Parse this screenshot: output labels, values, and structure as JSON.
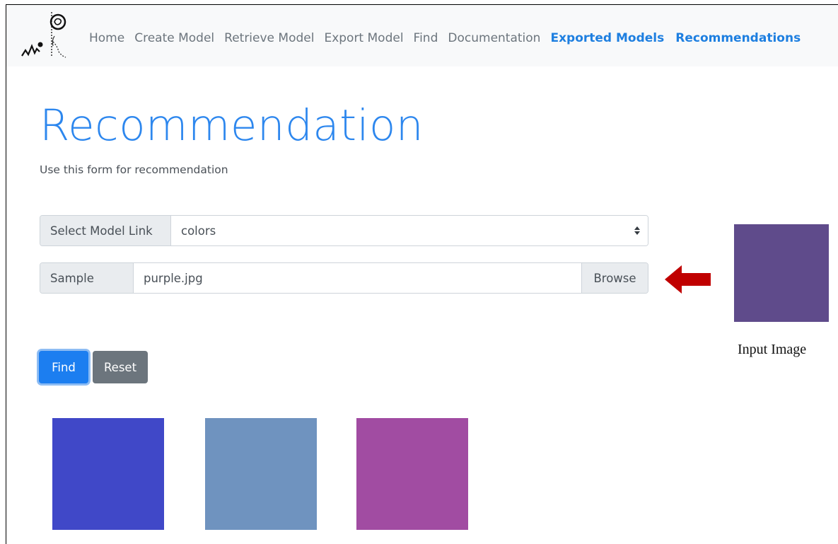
{
  "navbar": {
    "links": [
      {
        "label": "Home",
        "active": false
      },
      {
        "label": "Create Model",
        "active": false
      },
      {
        "label": "Retrieve Model",
        "active": false
      },
      {
        "label": "Export Model",
        "active": false
      },
      {
        "label": "Find",
        "active": false
      },
      {
        "label": "Documentation",
        "active": false
      },
      {
        "label": "Exported Models",
        "active": true
      },
      {
        "label": "Recommendations",
        "active": true
      }
    ]
  },
  "page": {
    "title": "Recommendation",
    "subtitle": "Use this form for recommendation"
  },
  "form": {
    "model": {
      "label": "Select Model Link",
      "value": "colors"
    },
    "sample": {
      "label": "Sample",
      "value": "purple.jpg",
      "browse_label": "Browse"
    },
    "find_label": "Find",
    "reset_label": "Reset"
  },
  "input_image": {
    "caption": "Input Image",
    "color": "#5f4b8b"
  },
  "results": [
    {
      "color": "#4048c8"
    },
    {
      "color": "#6f93bf"
    },
    {
      "color": "#a14ca2"
    }
  ],
  "icons": {
    "logo": "brain-lightbulb-logo-icon",
    "arrow": "left-arrow-icon",
    "caret": "sort-caret-icon"
  },
  "colors": {
    "accent": "#1c7ef0",
    "title": "#2d87ee",
    "arrow": "#c00000"
  }
}
